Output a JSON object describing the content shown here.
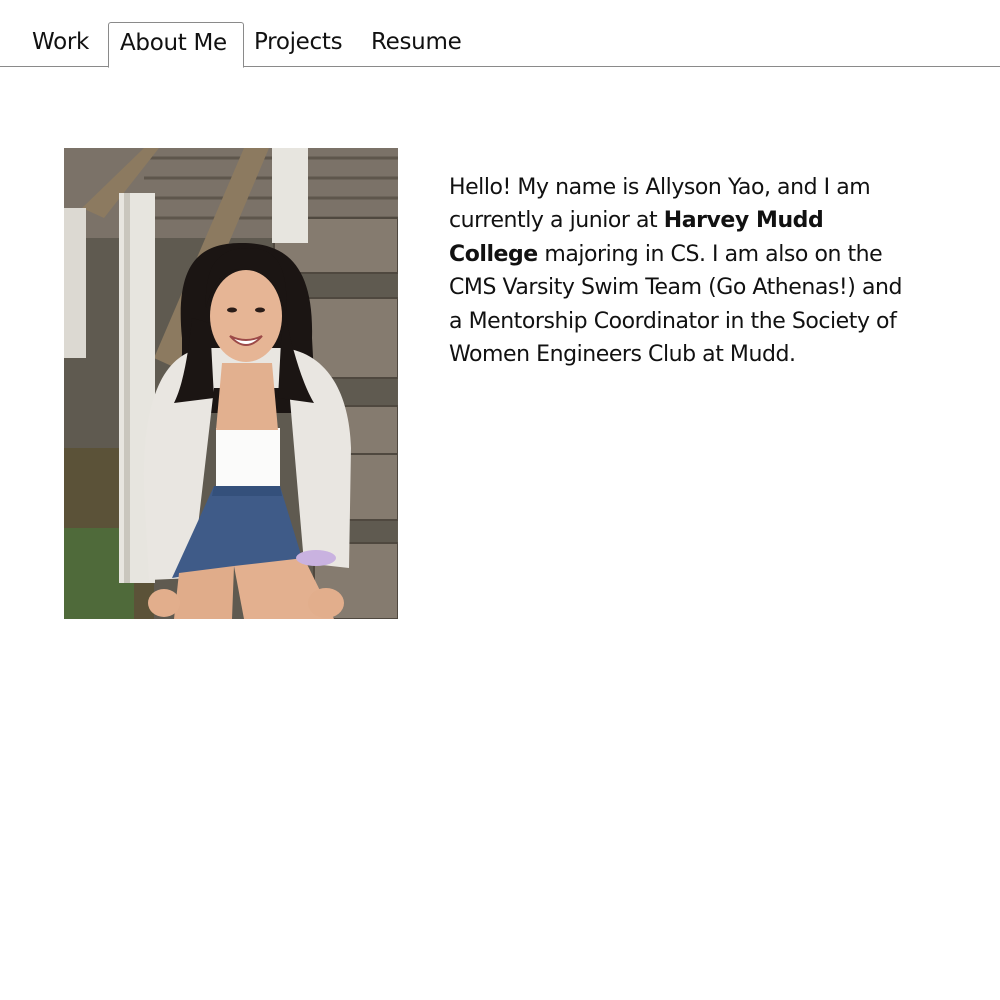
{
  "nav": {
    "tabs": [
      {
        "label": "Work",
        "active": false
      },
      {
        "label": "About Me",
        "active": true
      },
      {
        "label": "Projects",
        "active": false
      },
      {
        "label": "Resume",
        "active": false
      }
    ]
  },
  "about": {
    "photo_icon": "portrait-photo",
    "bio": {
      "part1": "Hello! My name is Allyson Yao, and I am currently a junior at ",
      "bold": "Harvey Mudd College",
      "part2": " majoring in CS. I am also on the CMS Varsity Swim Team (Go Athenas!) and a Mentorship Coordinator in the Society of Women Engineers Club at Mudd."
    }
  },
  "colors": {
    "border": "#8a8a8a",
    "text": "#111111",
    "background": "#ffffff"
  }
}
